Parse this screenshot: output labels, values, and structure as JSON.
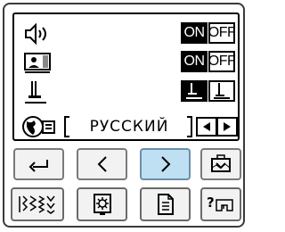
{
  "settings": {
    "sound": {
      "icon": "speaker-icon",
      "on_label": "ON",
      "off_label": "OFF",
      "selected": "ON"
    },
    "screen_saver": {
      "icon": "screen-image-icon",
      "on_label": "ON",
      "off_label": "OFF",
      "selected": "ON"
    },
    "presser_foot": {
      "icon": "presser-foot-icon",
      "selected": "up"
    },
    "language": {
      "icon": "globe-language-icon",
      "value": "РУССКИЙ"
    }
  },
  "nav": {
    "back": "return-arrow-icon",
    "prev": "chevron-left-icon",
    "next": "chevron-right-icon",
    "next_active": true,
    "embroidery": "embroidery-frame-icon"
  },
  "modes": [
    "utility-stitch-icon",
    "embroidery-pattern-icon",
    "settings-document-icon",
    "help-machine-icon"
  ],
  "colors": {
    "active": "#bfe0f3",
    "lcd_border": "#000000"
  }
}
